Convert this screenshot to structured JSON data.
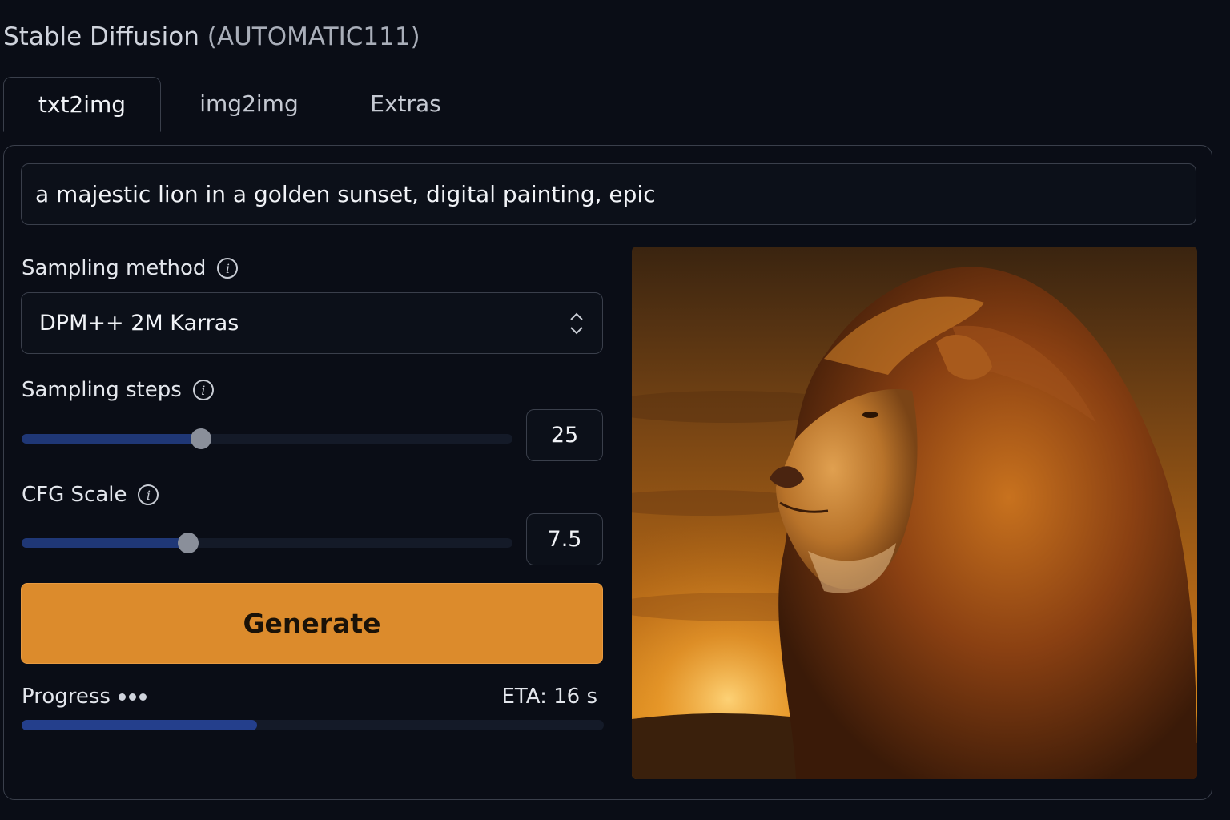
{
  "app": {
    "title": "Stable Diffusion",
    "subtitle": "(AUTOMATIC111)"
  },
  "tabs": [
    {
      "label": "txt2img",
      "active": true
    },
    {
      "label": "img2img",
      "active": false
    },
    {
      "label": "Extras",
      "active": false
    }
  ],
  "prompt": {
    "value": "a majestic lion in a golden sunset, digital painting, epic"
  },
  "sampling_method": {
    "label": "Sampling method",
    "value": "DPM++ 2M Karras",
    "icon": "info-icon"
  },
  "sampling_steps": {
    "label": "Sampling steps",
    "value": "25",
    "fraction": 0.365,
    "icon": "info-icon"
  },
  "cfg_scale": {
    "label": "CFG Scale",
    "value": "7.5",
    "fraction": 0.34,
    "icon": "info-icon"
  },
  "generate": {
    "label": "Generate",
    "color": "#dc8b2c"
  },
  "progress": {
    "label": "Progress",
    "eta": "ETA: 16 s",
    "fraction": 0.405
  },
  "output_image": {
    "subject": "lion-portrait-sunset"
  }
}
